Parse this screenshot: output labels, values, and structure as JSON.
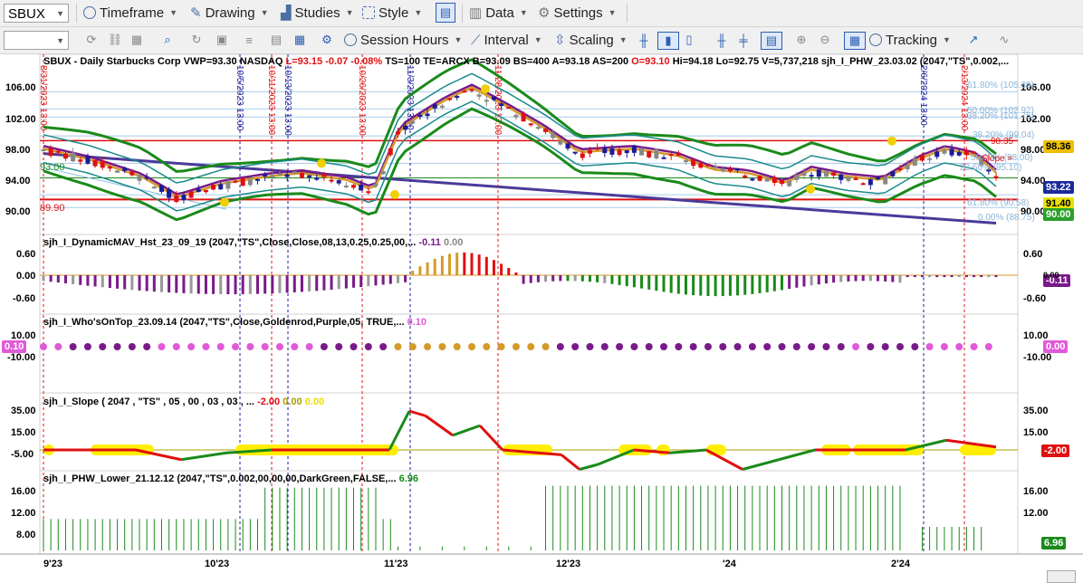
{
  "toolbar1": {
    "symbol": "SBUX",
    "timeframe": "Timeframe",
    "drawing": "Drawing",
    "studies": "Studies",
    "style": "Style",
    "data": "Data",
    "settings": "Settings"
  },
  "toolbar2": {
    "session_hours": "Session Hours",
    "interval": "Interval",
    "scaling": "Scaling",
    "tracking": "Tracking"
  },
  "colors": {
    "green": "#1a8a1a",
    "red": "#e01010",
    "navy": "#1a1a9a",
    "purple": "#7a1a8a",
    "gold": "#d49a2a",
    "teal": "#1a8a8a",
    "slate": "#4a3a9a",
    "magenta": "#e05ad8",
    "yellow": "#ffee00"
  },
  "price_pane": {
    "header": [
      {
        "text": "SBUX - Daily  Starbucks Corp  VWP=93.30  NASDAQ  ",
        "color": "#000"
      },
      {
        "text": "L=93.15  -0.07  -0.08%",
        "color": "#e01010"
      },
      {
        "text": "  TS=100  TE=ARCX  B=93.09  BS=400  A=93.18  AS=200  ",
        "color": "#000"
      },
      {
        "text": "O=93.10",
        "color": "#e01010"
      },
      {
        "text": "  Hi=94.18  Lo=92.75  V=5,737,218  sjh_I_PHW_23.03.02 (2047,\"TS\",0.002,...",
        "color": "#000"
      }
    ],
    "y_labels": [
      "106.00",
      "102.00",
      "98.00",
      "94.00",
      "90.00"
    ],
    "left_labels": [
      "93.00",
      "89.90"
    ],
    "fib_labels": [
      "61.80% (105.39)",
      "50.00% (102.92)",
      "38.20% (101.75)",
      "38.20% (99.04)",
      "98.35",
      "50.00% (98.00)",
      "Slope =",
      "23.60% (95.10)",
      "61.80% (90.58)",
      "0.00% (88.75)"
    ],
    "tags": [
      {
        "text": "98.36",
        "bg": "#f0c000",
        "fg": "#000"
      },
      {
        "text": "93.22",
        "bg": "#1a2a9a",
        "fg": "#fff"
      },
      {
        "text": "91.40",
        "bg": "#e8e000",
        "fg": "#000"
      },
      {
        "text": "90.00",
        "bg": "#2aa02a",
        "fg": "#fff"
      }
    ],
    "date_markers": [
      {
        "text": "8/31/2023 13:00",
        "color": "#e01010"
      },
      {
        "text": "10/5/2023 13:00",
        "color": "#1a1a9a"
      },
      {
        "text": "10/11/2023 13:00",
        "color": "#e01010"
      },
      {
        "text": "10/13/2023 13:00",
        "color": "#1a1a9a"
      },
      {
        "text": "10/26/2023 13:00",
        "color": "#e01010"
      },
      {
        "text": "11/3/2023 13:00",
        "color": "#1a1a9a"
      },
      {
        "text": "11/28/2023 13:00",
        "color": "#e01010"
      },
      {
        "text": "2/6/2024 13:00",
        "color": "#1a1a9a"
      },
      {
        "text": "2/13/2024 13:00",
        "color": "#e01010"
      }
    ]
  },
  "mav_pane": {
    "header": "sjh_I_DynamicMAV_Hst_23_09_19 (2047,\"TS\",Close,Close,08,13,0.25,0.25,00,...",
    "v1": "-0.11",
    "v2": "0.00",
    "y_labels": [
      "0.60",
      "0.00",
      "-0.60"
    ],
    "tag": "-0.11"
  },
  "who_pane": {
    "header": "sjh_I_Who'sOnTop_23.09.14 (2047,\"TS\",Close,Goldenrod,Purple,05,  TRUE,...",
    "v1": "0.10",
    "y_labels": [
      "10.00",
      "0.00",
      "-10.00"
    ],
    "tag": "0.10"
  },
  "slope_pane": {
    "header": "sjh_I_Slope ( 2047 , \"TS\" , 05 , 00 , 03 , 03 , ...",
    "v1": "-2.00",
    "v2": "0.00",
    "v3": "0.00",
    "y_labels": [
      "35.00",
      "15.00",
      "-5.00"
    ],
    "tag": "-2.00"
  },
  "phw_pane": {
    "header": "sjh_I_PHW_Lower_21.12.12 (2047,\"TS\",0.002,00,00,00,DarkGreen,FALSE,...",
    "v1": "6.96",
    "y_labels": [
      "16.00",
      "12.00",
      "8.00"
    ],
    "tag": "6.96"
  },
  "x_axis": [
    "9'23",
    "10'23",
    "11'23",
    "12'23",
    "'24",
    "2'24"
  ]
}
